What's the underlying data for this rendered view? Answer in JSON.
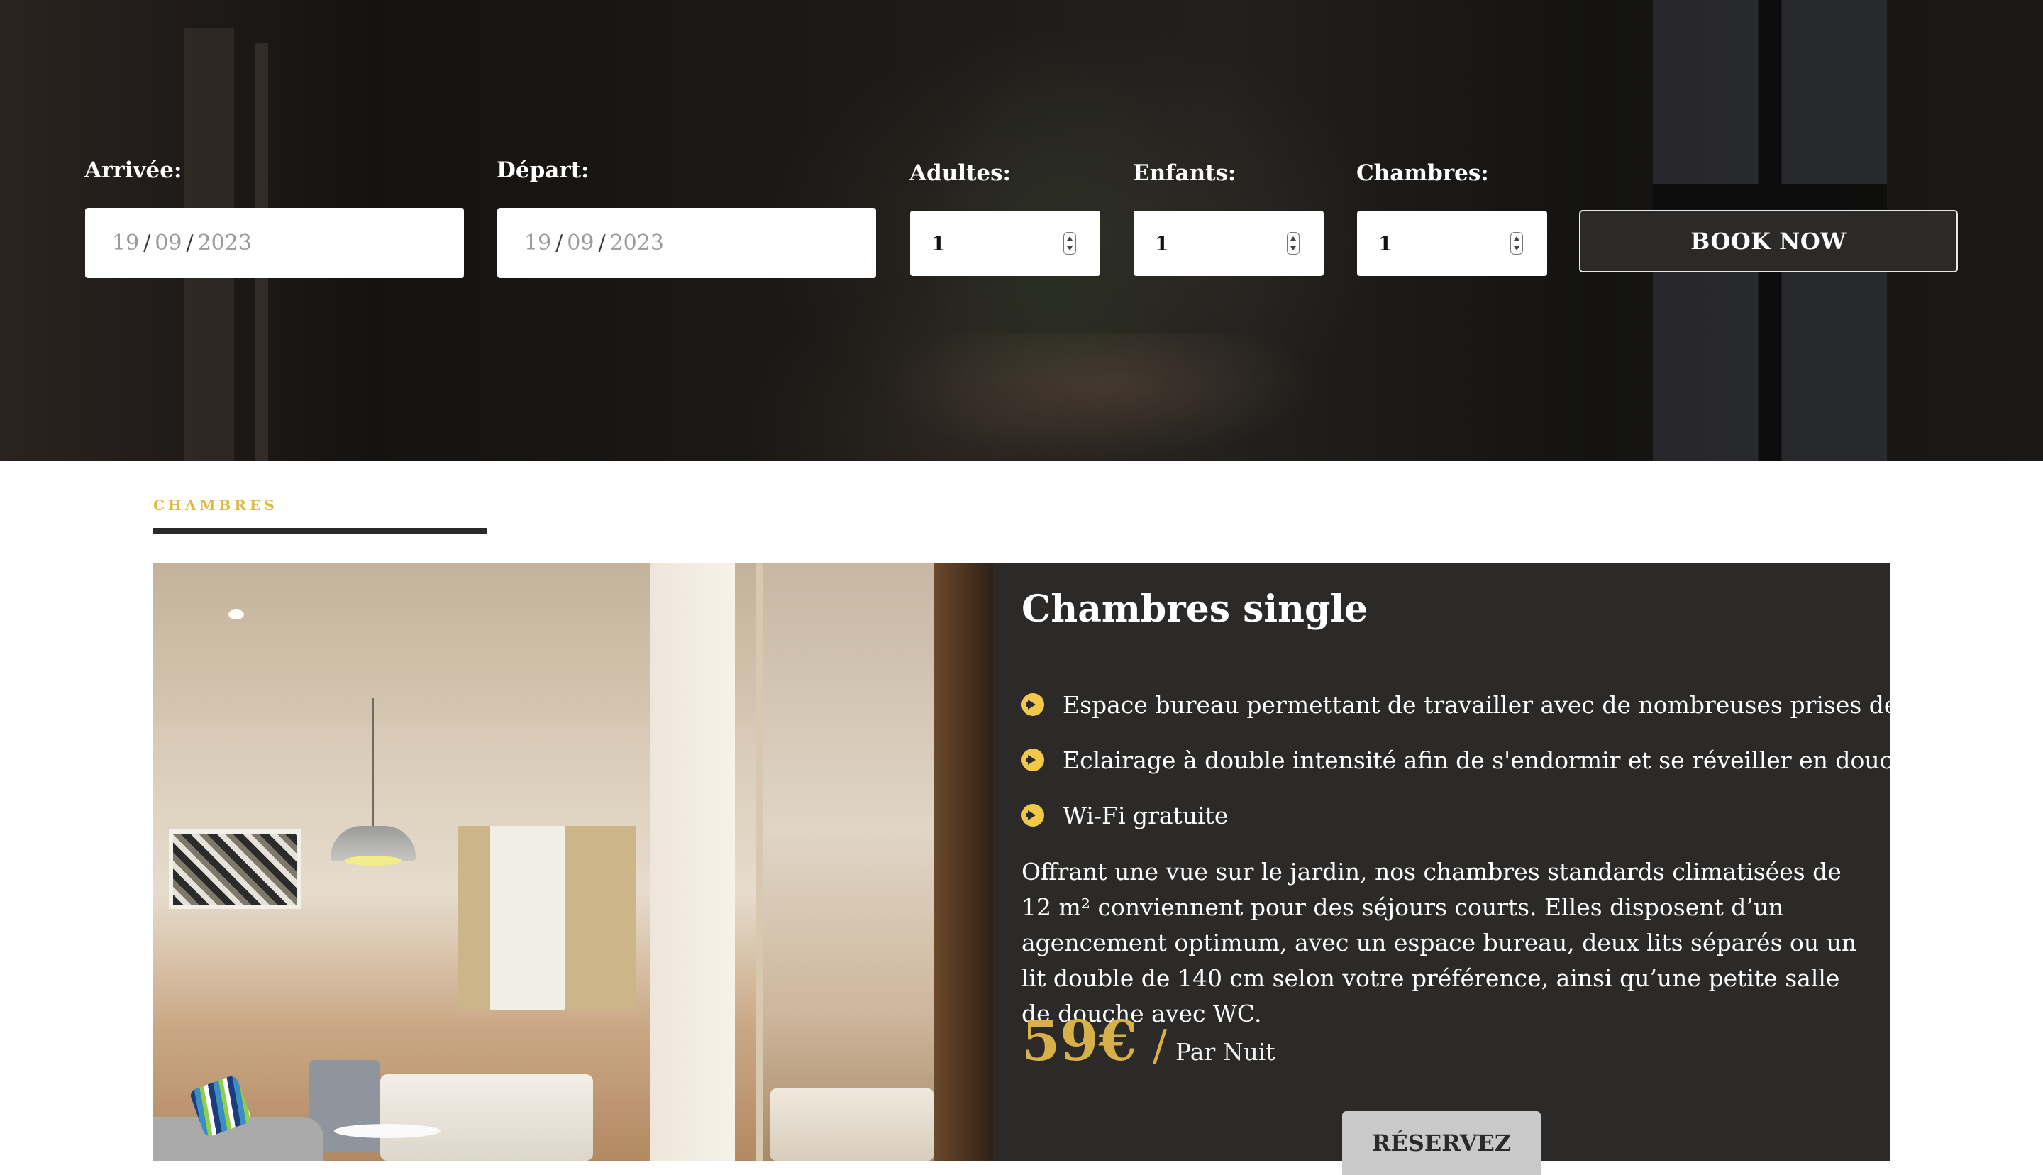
{
  "booking": {
    "arrival": {
      "label": "Arrivée:",
      "day": "19",
      "month": "09",
      "year": "2023"
    },
    "departure": {
      "label": "Départ:",
      "day": "19",
      "month": "09",
      "year": "2023"
    },
    "adults": {
      "label": "Adultes:",
      "value": "1"
    },
    "children": {
      "label": "Enfants:",
      "value": "1"
    },
    "rooms": {
      "label": "Chambres:",
      "value": "1"
    },
    "book_button": "BOOK NOW"
  },
  "section": {
    "eyebrow": "CHAMBRES"
  },
  "room": {
    "title": "Chambres single",
    "features": [
      "Espace bureau permettant de travailler avec de nombreuses prises de courant.",
      "Eclairage à double intensité afin de s'endormir et se réveiller en douceur.",
      "Wi-Fi gratuite"
    ],
    "description": "Offrant une vue sur le jardin, nos chambres standards climatisées de 12 m² conviennent pour des séjours courts. Elles disposent d’un agencement optimum, avec un espace bureau, deux lits séparés ou un lit double de 140 cm selon votre préférence, ainsi qu’une petite salle de douche avec WC.",
    "price": "59€",
    "price_slash": "/",
    "price_unit": "Par Nuit",
    "reserve_button": "RÉSERVEZ"
  },
  "colors": {
    "accent": "#d8b04a",
    "icon_accent": "#f2c84b",
    "panel": "#2b2a28"
  },
  "icons": {
    "feature": "arrow-circle-right-icon"
  }
}
